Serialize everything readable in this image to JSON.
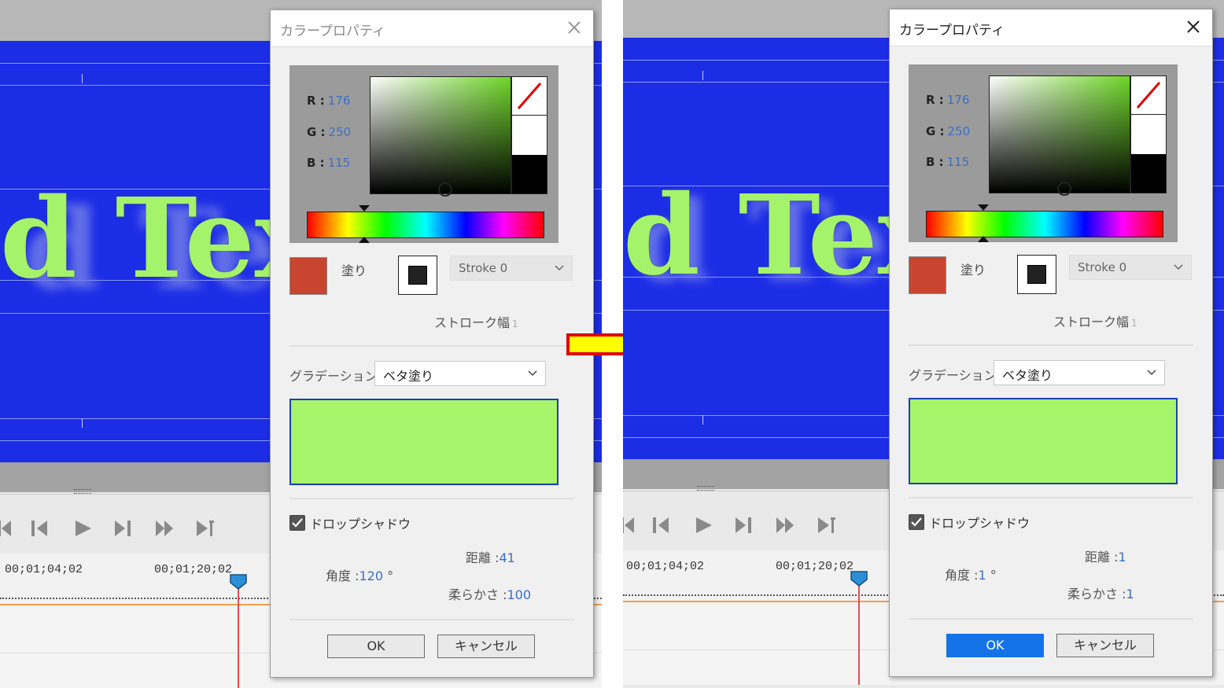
{
  "before": {
    "canvas_text": "d Tex",
    "timecodes": [
      "00;01;04;02",
      "00;01;20;02"
    ],
    "dialog": {
      "title": "カラープロパティ",
      "rgb": {
        "r_label": "R :",
        "r": "176",
        "g_label": "G :",
        "g": "250",
        "b_label": "B :",
        "b": "115"
      },
      "fill_label": "塗り",
      "stroke_select": "Stroke 0",
      "stroke_width_label": "ストローク幅",
      "stroke_width": "1",
      "gradation_label": "グラデーション",
      "gradation_value": "ベタ塗り",
      "drop_shadow_label": "ドロップシャドウ",
      "drop_shadow_checked": true,
      "distance_label": "距離 :",
      "distance": "41",
      "angle_label": "角度 :",
      "angle": "120",
      "angle_unit": "°",
      "softness_label": "柔らかさ :",
      "softness": "100",
      "ok": "OK",
      "cancel": "キャンセル",
      "fill_color": "#c84530",
      "preview_color": "#a8f46b"
    }
  },
  "after": {
    "canvas_text": "d Tex",
    "timecodes": [
      "00;01;04;02",
      "00;01;20;02"
    ],
    "dialog": {
      "title": "カラープロパティ",
      "rgb": {
        "r_label": "R :",
        "r": "176",
        "g_label": "G :",
        "g": "250",
        "b_label": "B :",
        "b": "115"
      },
      "fill_label": "塗り",
      "stroke_select": "Stroke 0",
      "stroke_width_label": "ストローク幅",
      "stroke_width": "1",
      "gradation_label": "グラデーション",
      "gradation_value": "ベタ塗り",
      "drop_shadow_label": "ドロップシャドウ",
      "drop_shadow_checked": true,
      "distance_label": "距離 :",
      "distance": "1",
      "angle_label": "角度 :",
      "angle": "1",
      "angle_unit": "°",
      "softness_label": "柔らかさ :",
      "softness": "1",
      "ok": "OK",
      "cancel": "キャンセル",
      "fill_color": "#c84530",
      "preview_color": "#a8f46b"
    }
  },
  "arrow": {
    "fill": "#ffff00",
    "stroke": "#e00000",
    "icon": "right-arrow-icon"
  },
  "colors": {
    "canvas_bg": "#1c2de6",
    "text_fill": "#a5f26b",
    "ok_primary": "#1473e6",
    "value_blue": "#3a6fc6"
  }
}
